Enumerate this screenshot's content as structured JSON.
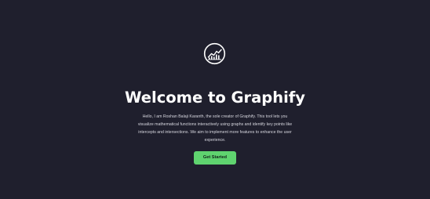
{
  "icons": {
    "logo": "graph-chart-icon"
  },
  "colors": {
    "background": "#1f1f2d",
    "title": "#ffffff",
    "body_text": "#d6d6de",
    "accent": "#5fd36f"
  },
  "hero": {
    "title": "Welcome to Graphify",
    "intro": "Hello, I am Roshan Balaji Karanth, the sole creator of Graphify. This tool lets you visualize mathematical functions interactively using graphs and identify key points like intercepts and intersections. We aim to implement more features to enhance the user experience.",
    "cta_label": "Get Started"
  }
}
